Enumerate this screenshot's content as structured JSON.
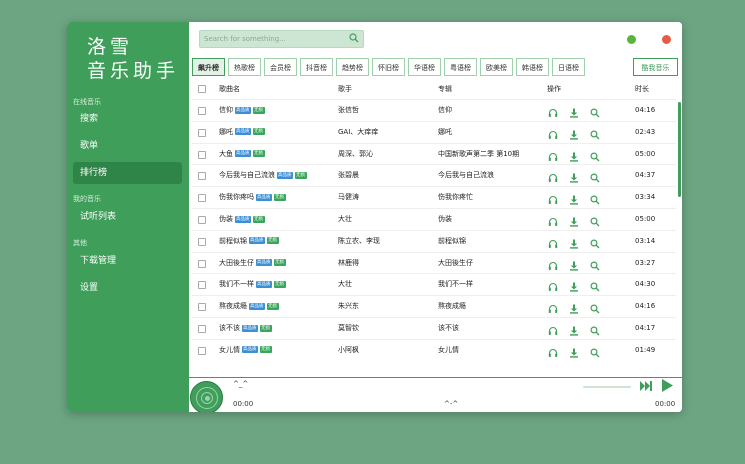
{
  "app": {
    "logo_line1": "洛雪",
    "logo_line2": "音乐助手"
  },
  "sidebar": {
    "section_online": "在线音乐",
    "search": "搜索",
    "songlist": "歌单",
    "leaderboard": "排行榜",
    "section_mine": "我的音乐",
    "trial_list": "试听列表",
    "section_other": "其他",
    "download_manage": "下载管理",
    "settings": "设置"
  },
  "search": {
    "placeholder": "Search for something..."
  },
  "tabs": [
    "飙升榜",
    "热歌榜",
    "会员榜",
    "抖音榜",
    "趋势榜",
    "怀旧榜",
    "华语榜",
    "粤语榜",
    "欧美榜",
    "韩语榜",
    "日语榜"
  ],
  "source_label": "酷我音乐",
  "table": {
    "headers": {
      "name": "歌曲名",
      "singer": "歌手",
      "album": "专辑",
      "ops": "操作",
      "duration": "时长"
    },
    "badge_hq": "高品质",
    "badge_lossless": "无损",
    "rows": [
      {
        "name": "信仰",
        "singer": "张信哲",
        "album": "信仰",
        "duration": "04:16"
      },
      {
        "name": "娜吒",
        "singer": "GAI、大痒痒",
        "album": "娜吒",
        "duration": "02:43"
      },
      {
        "name": "大鱼",
        "singer": "周深、郭沁",
        "album": "中国新歌声第二季 第10期",
        "duration": "05:00"
      },
      {
        "name": "今后我与自己流浪",
        "singer": "张碧晨",
        "album": "今后我与自己流浪",
        "duration": "04:37"
      },
      {
        "name": "伤我你疼吗",
        "singer": "马健涛",
        "album": "伤我你疼忙",
        "duration": "03:34"
      },
      {
        "name": "伪装",
        "singer": "大壮",
        "album": "伪装",
        "duration": "05:00"
      },
      {
        "name": "前程似锦",
        "singer": "陈立农、李现",
        "album": "前程似锦",
        "duration": "03:14"
      },
      {
        "name": "大田後生仔",
        "singer": "林鹿得",
        "album": "大田後生仔",
        "duration": "03:27"
      },
      {
        "name": "我们不一样",
        "singer": "大壮",
        "album": "我们不一样",
        "duration": "04:30"
      },
      {
        "name": "熬夜成瘾",
        "singer": "朱兴东",
        "album": "熬夜成瘾",
        "duration": "04:16"
      },
      {
        "name": "该不该",
        "singer": "莫智钦",
        "album": "该不该",
        "duration": "04:17"
      },
      {
        "name": "女儿情",
        "singer": "小阿枫",
        "album": "女儿情",
        "duration": "01:49"
      }
    ]
  },
  "player": {
    "title": "^_^",
    "time_current": "00:00",
    "time_total": "00:00",
    "lyric": "^-^"
  },
  "colors": {
    "background": "#6da582",
    "primary": "#3f9e5a",
    "active_nav": "#2f8448",
    "badge_hq": "#3c8fd5",
    "badge_lossless": "#3aa65d",
    "dot_green": "#5cb53a",
    "dot_red": "#e45b47"
  }
}
